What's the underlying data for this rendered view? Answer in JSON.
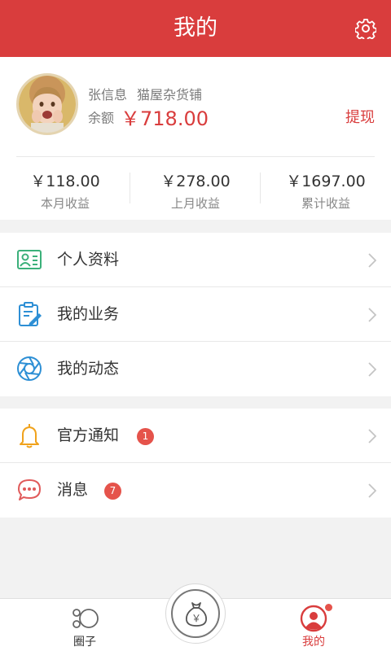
{
  "header": {
    "title": "我的"
  },
  "profile": {
    "name": "张信息",
    "shop": "猫屋杂货铺",
    "balance_label": "余额",
    "balance_value": "￥718.00",
    "withdraw_label": "提现"
  },
  "stats": [
    {
      "value": "￥118.00",
      "label": "本月收益"
    },
    {
      "value": "￥278.00",
      "label": "上月收益"
    },
    {
      "value": "￥1697.00",
      "label": "累计收益"
    }
  ],
  "menu_group_1": [
    {
      "label": "个人资料",
      "icon": "profile-card-icon"
    },
    {
      "label": "我的业务",
      "icon": "business-clipboard-icon"
    },
    {
      "label": "我的动态",
      "icon": "aperture-icon"
    }
  ],
  "menu_group_2": [
    {
      "label": "官方通知",
      "icon": "bell-icon",
      "badge": "1"
    },
    {
      "label": "消息",
      "icon": "chat-bubble-icon",
      "badge": "7"
    }
  ],
  "tabbar": {
    "circle_label": "圈子",
    "mine_label": "我的",
    "center_icon": "money-bag-icon",
    "center_symbol": "￥"
  },
  "colors": {
    "brand": "#d93d3d",
    "badge": "#e5534b",
    "menu_green": "#3bb07a",
    "menu_blue": "#2d8fd5",
    "menu_orange": "#f0a21c",
    "menu_red": "#e05a5a"
  }
}
